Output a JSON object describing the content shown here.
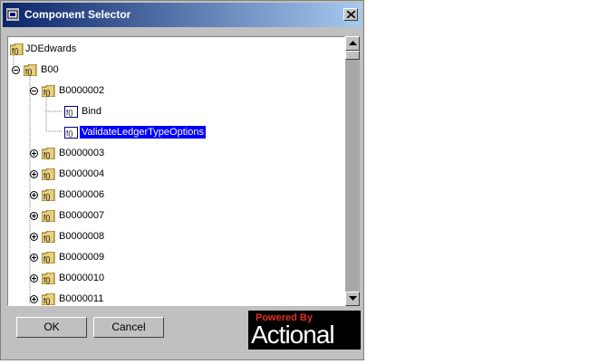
{
  "window": {
    "title": "Component Selector"
  },
  "tree": {
    "root": "JDEdwards",
    "level1": "B00",
    "expanded": "B0000002",
    "children": [
      "Bind",
      "ValidateLedgerTypeOptions"
    ],
    "selected": "ValidateLedgerTypeOptions",
    "siblings": [
      "B0000003",
      "B0000004",
      "B0000006",
      "B0000007",
      "B0000008",
      "B0000009",
      "B0000010",
      "B0000011"
    ]
  },
  "buttons": {
    "ok": "OK",
    "cancel": "Cancel"
  },
  "logo": {
    "top": "Powered By",
    "name": "Actional"
  },
  "icons": {
    "function_icon": "f()-icon",
    "folder": "folder-icon"
  },
  "colors": {
    "selection": "#0000ff",
    "title_start": "#0a246a",
    "title_end": "#a6caf0"
  }
}
